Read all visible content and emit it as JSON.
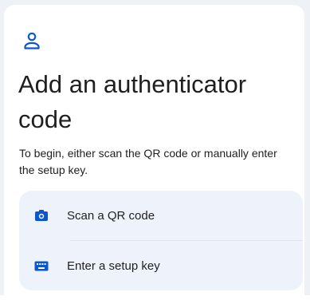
{
  "header": {
    "icon": "person-icon",
    "title": "Add an authenticator code",
    "description": "To begin, either scan the QR code or manually enter the setup key."
  },
  "options": [
    {
      "icon": "camera-icon",
      "label": "Scan a QR code"
    },
    {
      "icon": "keyboard-icon",
      "label": "Enter a setup key"
    }
  ],
  "colors": {
    "accent": "#0b57d0",
    "option_bg": "#eef3fb",
    "text": "#1f1f1f"
  }
}
